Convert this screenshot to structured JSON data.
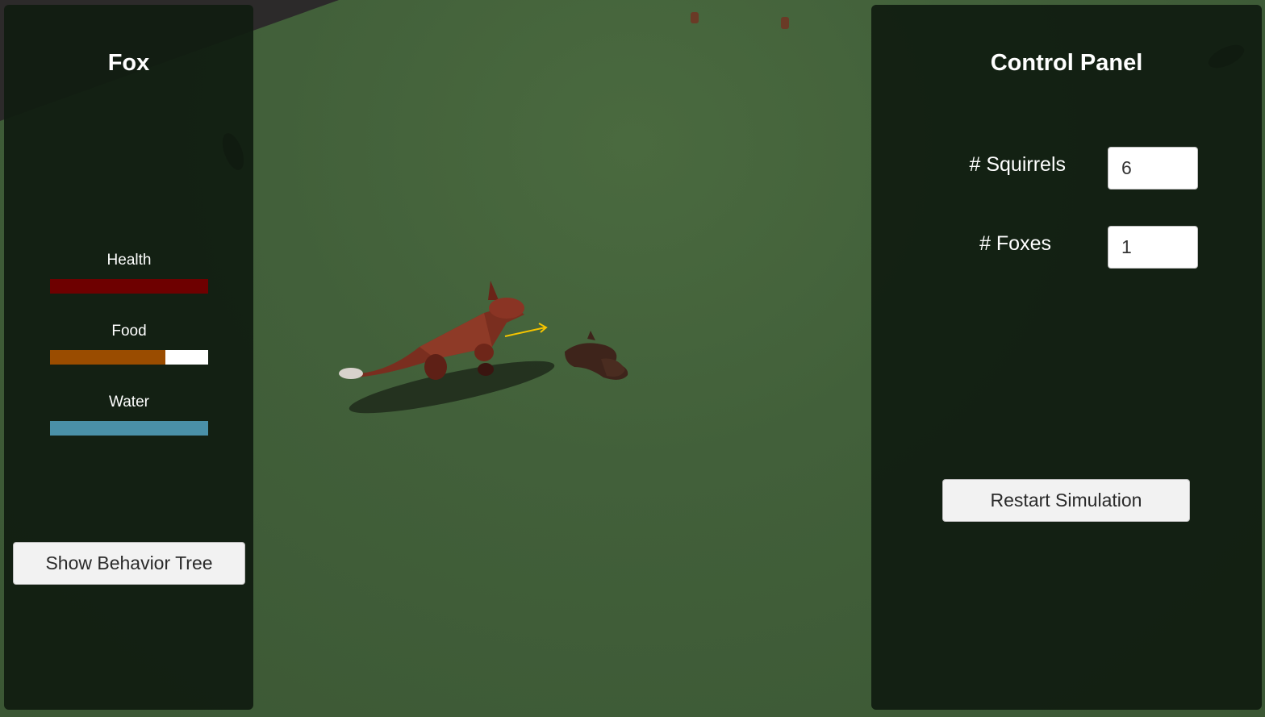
{
  "left_panel": {
    "title": "Fox",
    "stats": [
      {
        "label": "Health",
        "level": 1.0,
        "color": "#6e0000"
      },
      {
        "label": "Food",
        "level": 0.73,
        "color": "#9a4c00"
      },
      {
        "label": "Water",
        "level": 1.0,
        "color": "#4a90a8"
      }
    ],
    "show_tree_button": "Show Behavior Tree"
  },
  "right_panel": {
    "title": "Control Panel",
    "fields": [
      {
        "label": "# Squirrels",
        "value": "6"
      },
      {
        "label": "# Foxes",
        "value": "1"
      }
    ],
    "restart_button": "Restart Simulation"
  },
  "scene": {
    "ground_color": "#42603a",
    "sky_color": "#2c2a2a",
    "arrow_color": "#f5c400"
  }
}
